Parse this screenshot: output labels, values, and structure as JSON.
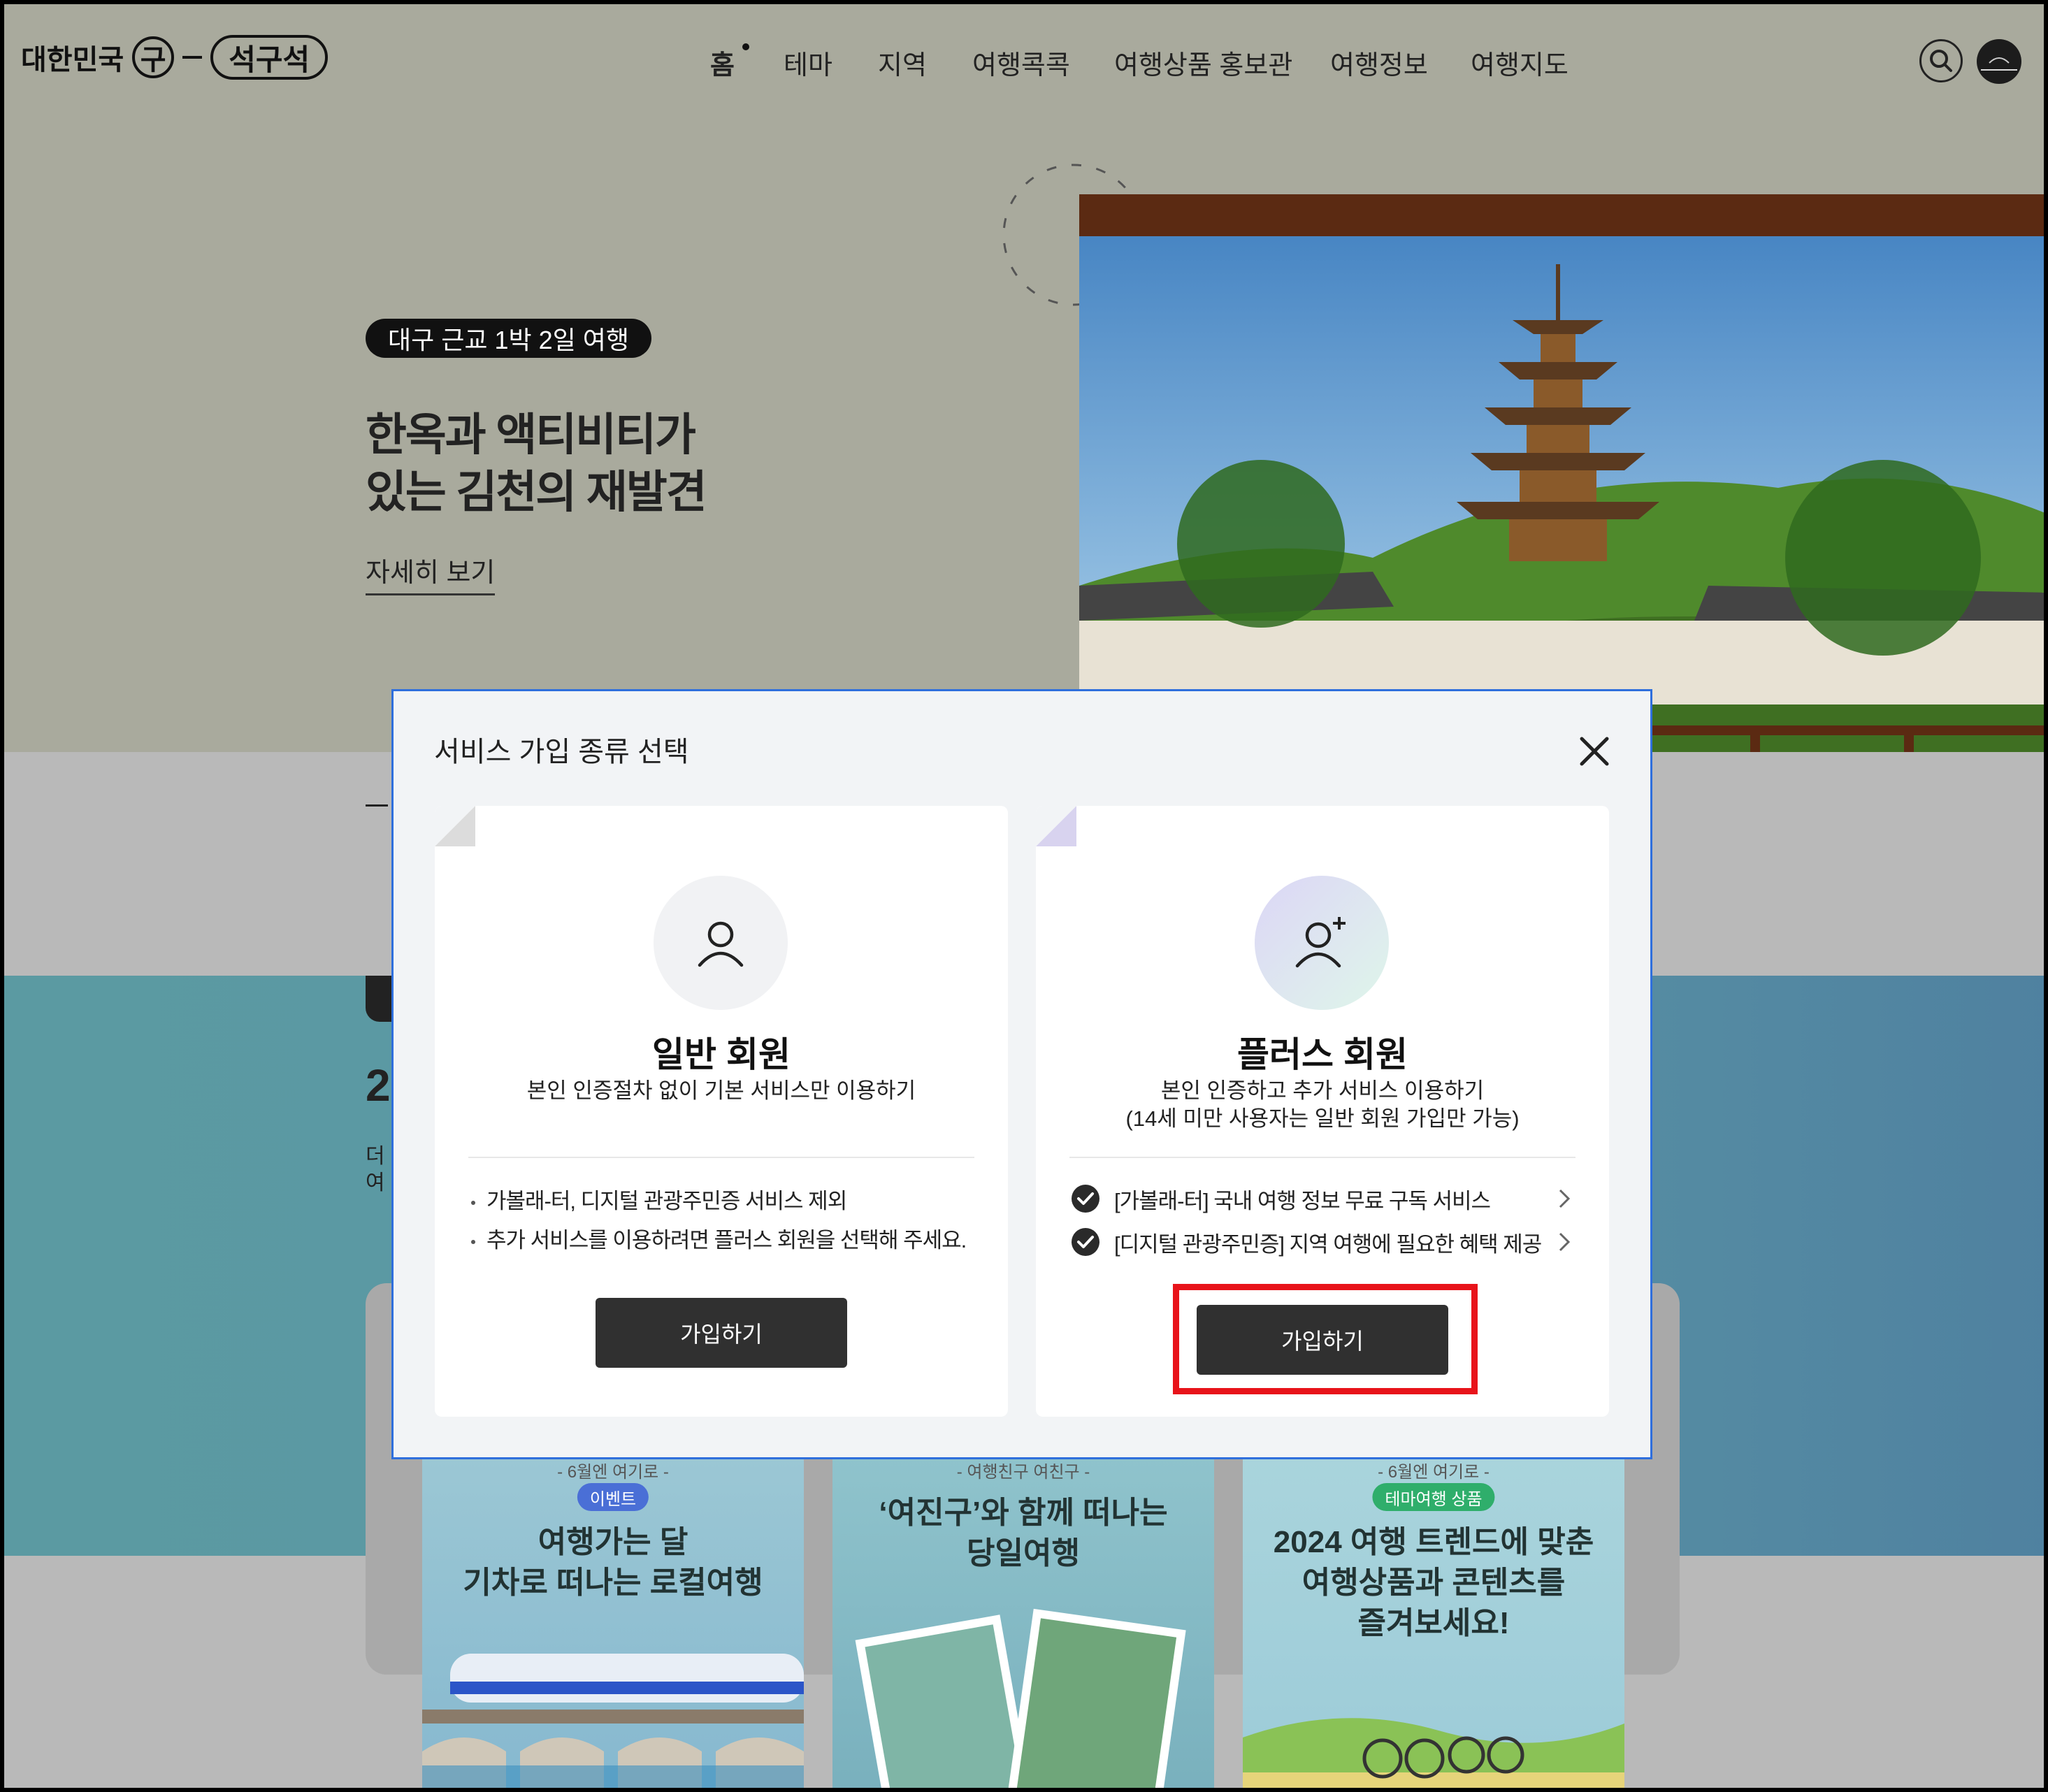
{
  "header": {
    "logo": {
      "prefix": "대한민국",
      "circle_char": "구",
      "pill_text": "석구석"
    },
    "nav": [
      "홈",
      "테마",
      "지역",
      "여행콕콕",
      "여행상품 홍보관",
      "여행정보",
      "여행지도"
    ],
    "icons": [
      "search-icon",
      "avatar-icon"
    ]
  },
  "hero": {
    "badge": "대구 근교 1박 2일 여행",
    "title_line1": "한옥과 액티비티가",
    "title_line2": "있는 김천의 재발견",
    "more_link": "자세히 보기"
  },
  "cards": [
    {
      "kicker": "- 6월엔 여기로 -",
      "tag": "이벤트",
      "line1": "여행가는 달",
      "line2": "기차로 떠나는 로컬여행",
      "tag_color": "#4a6fd6"
    },
    {
      "kicker": "- 여행친구 여친구 -",
      "line1": "‘여진구’와 함께 떠나는",
      "line2": "당일여행"
    },
    {
      "kicker": "- 6월엔 여기로 -",
      "tag": "테마여행 상품",
      "line1": "2024 여행 트렌드에 맞춘",
      "line2": "여행상품과 콘텐츠를",
      "line3": "즐겨보세요!",
      "tag_color": "#2fae6b"
    }
  ],
  "modal": {
    "title": "서비스 가입 종류 선택",
    "close_icon": "close-icon",
    "general": {
      "name": "일반 회원",
      "desc": "본인 인증절차 없이 기본 서비스만 이용하기",
      "bullets": [
        "가볼래-터, 디지털 관광주민증 서비스 제외",
        "추가 서비스를 이용하려면 플러스 회원을 선택해 주세요."
      ],
      "button": "가입하기"
    },
    "plus": {
      "name": "플러스 회원",
      "desc_line1": "본인 인증하고 추가 서비스 이용하기",
      "desc_line2": "(14세 미만 사용자는 일반 회원 가입만 가능)",
      "features": [
        "[가볼래-터] 국내 여행 정보 무료 구독 서비스",
        "[디지털 관광주민증] 지역 여행에 필요한 혜택 제공"
      ],
      "button": "가입하기"
    }
  },
  "colors": {
    "modal_border": "#2f6fdc",
    "highlight": "#e8131a",
    "button": "#303030"
  }
}
